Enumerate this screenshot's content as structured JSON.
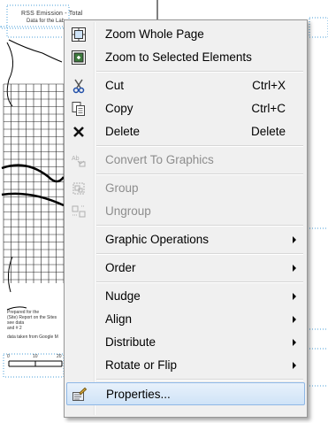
{
  "layout_view": {
    "title": "RSS Emission - Total",
    "subtitle": "Data for the Lab",
    "legend_lines": [
      "Prepared for the",
      "(Site) Report on the Sites",
      "see data",
      "and # 2",
      "data taken from Google M"
    ],
    "scale_labels": [
      "0",
      "10",
      "20"
    ]
  },
  "context_menu": {
    "items": [
      {
        "id": "zoom-whole-page",
        "label": "Zoom Whole Page",
        "shortcut": "",
        "icon": "zoom-page-icon",
        "submenu": false,
        "enabled": true,
        "highlighted": false
      },
      {
        "id": "zoom-selected",
        "label": "Zoom to Selected Elements",
        "shortcut": "",
        "icon": "zoom-selected-icon",
        "submenu": false,
        "enabled": true,
        "highlighted": false
      },
      {
        "id": "cut",
        "label": "Cut",
        "shortcut": "Ctrl+X",
        "icon": "scissors-icon",
        "submenu": false,
        "enabled": true,
        "highlighted": false
      },
      {
        "id": "copy",
        "label": "Copy",
        "shortcut": "Ctrl+C",
        "icon": "copy-icon",
        "submenu": false,
        "enabled": true,
        "highlighted": false
      },
      {
        "id": "delete",
        "label": "Delete",
        "shortcut": "Delete",
        "icon": "delete-x-icon",
        "submenu": false,
        "enabled": true,
        "highlighted": false
      },
      {
        "id": "convert-to-graphics",
        "label": "Convert To Graphics",
        "shortcut": "",
        "icon": "convert-graphics-icon",
        "submenu": false,
        "enabled": false,
        "highlighted": false
      },
      {
        "id": "group",
        "label": "Group",
        "shortcut": "",
        "icon": "group-icon",
        "submenu": false,
        "enabled": false,
        "highlighted": false
      },
      {
        "id": "ungroup",
        "label": "Ungroup",
        "shortcut": "",
        "icon": "ungroup-icon",
        "submenu": false,
        "enabled": false,
        "highlighted": false
      },
      {
        "id": "graphic-operations",
        "label": "Graphic Operations",
        "shortcut": "",
        "icon": "",
        "submenu": true,
        "enabled": true,
        "highlighted": false
      },
      {
        "id": "order",
        "label": "Order",
        "shortcut": "",
        "icon": "",
        "submenu": true,
        "enabled": true,
        "highlighted": false
      },
      {
        "id": "nudge",
        "label": "Nudge",
        "shortcut": "",
        "icon": "",
        "submenu": true,
        "enabled": true,
        "highlighted": false
      },
      {
        "id": "align",
        "label": "Align",
        "shortcut": "",
        "icon": "",
        "submenu": true,
        "enabled": true,
        "highlighted": false
      },
      {
        "id": "distribute",
        "label": "Distribute",
        "shortcut": "",
        "icon": "",
        "submenu": true,
        "enabled": true,
        "highlighted": false
      },
      {
        "id": "rotate-or-flip",
        "label": "Rotate or Flip",
        "shortcut": "",
        "icon": "",
        "submenu": true,
        "enabled": true,
        "highlighted": false
      },
      {
        "id": "properties",
        "label": "Properties...",
        "shortcut": "",
        "icon": "properties-icon",
        "submenu": false,
        "enabled": true,
        "highlighted": true
      }
    ]
  },
  "colors": {
    "menu_bg": "#f0f0f0",
    "highlight_border": "#8eb7e6",
    "disabled_text": "#8d8d8d",
    "grid_line": "#222222"
  }
}
